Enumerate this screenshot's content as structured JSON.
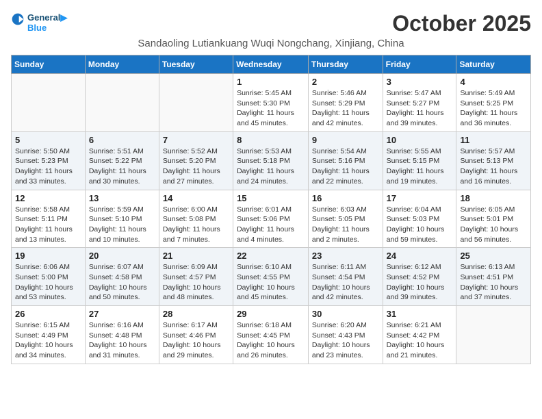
{
  "logo": {
    "line1": "General",
    "line2": "Blue"
  },
  "title": "October 2025",
  "subtitle": "Sandaoling Lutiankuang Wuqi Nongchang, Xinjiang, China",
  "headers": [
    "Sunday",
    "Monday",
    "Tuesday",
    "Wednesday",
    "Thursday",
    "Friday",
    "Saturday"
  ],
  "weeks": [
    [
      {
        "day": "",
        "info": ""
      },
      {
        "day": "",
        "info": ""
      },
      {
        "day": "",
        "info": ""
      },
      {
        "day": "1",
        "info": "Sunrise: 5:45 AM\nSunset: 5:30 PM\nDaylight: 11 hours\nand 45 minutes."
      },
      {
        "day": "2",
        "info": "Sunrise: 5:46 AM\nSunset: 5:29 PM\nDaylight: 11 hours\nand 42 minutes."
      },
      {
        "day": "3",
        "info": "Sunrise: 5:47 AM\nSunset: 5:27 PM\nDaylight: 11 hours\nand 39 minutes."
      },
      {
        "day": "4",
        "info": "Sunrise: 5:49 AM\nSunset: 5:25 PM\nDaylight: 11 hours\nand 36 minutes."
      }
    ],
    [
      {
        "day": "5",
        "info": "Sunrise: 5:50 AM\nSunset: 5:23 PM\nDaylight: 11 hours\nand 33 minutes."
      },
      {
        "day": "6",
        "info": "Sunrise: 5:51 AM\nSunset: 5:22 PM\nDaylight: 11 hours\nand 30 minutes."
      },
      {
        "day": "7",
        "info": "Sunrise: 5:52 AM\nSunset: 5:20 PM\nDaylight: 11 hours\nand 27 minutes."
      },
      {
        "day": "8",
        "info": "Sunrise: 5:53 AM\nSunset: 5:18 PM\nDaylight: 11 hours\nand 24 minutes."
      },
      {
        "day": "9",
        "info": "Sunrise: 5:54 AM\nSunset: 5:16 PM\nDaylight: 11 hours\nand 22 minutes."
      },
      {
        "day": "10",
        "info": "Sunrise: 5:55 AM\nSunset: 5:15 PM\nDaylight: 11 hours\nand 19 minutes."
      },
      {
        "day": "11",
        "info": "Sunrise: 5:57 AM\nSunset: 5:13 PM\nDaylight: 11 hours\nand 16 minutes."
      }
    ],
    [
      {
        "day": "12",
        "info": "Sunrise: 5:58 AM\nSunset: 5:11 PM\nDaylight: 11 hours\nand 13 minutes."
      },
      {
        "day": "13",
        "info": "Sunrise: 5:59 AM\nSunset: 5:10 PM\nDaylight: 11 hours\nand 10 minutes."
      },
      {
        "day": "14",
        "info": "Sunrise: 6:00 AM\nSunset: 5:08 PM\nDaylight: 11 hours\nand 7 minutes."
      },
      {
        "day": "15",
        "info": "Sunrise: 6:01 AM\nSunset: 5:06 PM\nDaylight: 11 hours\nand 4 minutes."
      },
      {
        "day": "16",
        "info": "Sunrise: 6:03 AM\nSunset: 5:05 PM\nDaylight: 11 hours\nand 2 minutes."
      },
      {
        "day": "17",
        "info": "Sunrise: 6:04 AM\nSunset: 5:03 PM\nDaylight: 10 hours\nand 59 minutes."
      },
      {
        "day": "18",
        "info": "Sunrise: 6:05 AM\nSunset: 5:01 PM\nDaylight: 10 hours\nand 56 minutes."
      }
    ],
    [
      {
        "day": "19",
        "info": "Sunrise: 6:06 AM\nSunset: 5:00 PM\nDaylight: 10 hours\nand 53 minutes."
      },
      {
        "day": "20",
        "info": "Sunrise: 6:07 AM\nSunset: 4:58 PM\nDaylight: 10 hours\nand 50 minutes."
      },
      {
        "day": "21",
        "info": "Sunrise: 6:09 AM\nSunset: 4:57 PM\nDaylight: 10 hours\nand 48 minutes."
      },
      {
        "day": "22",
        "info": "Sunrise: 6:10 AM\nSunset: 4:55 PM\nDaylight: 10 hours\nand 45 minutes."
      },
      {
        "day": "23",
        "info": "Sunrise: 6:11 AM\nSunset: 4:54 PM\nDaylight: 10 hours\nand 42 minutes."
      },
      {
        "day": "24",
        "info": "Sunrise: 6:12 AM\nSunset: 4:52 PM\nDaylight: 10 hours\nand 39 minutes."
      },
      {
        "day": "25",
        "info": "Sunrise: 6:13 AM\nSunset: 4:51 PM\nDaylight: 10 hours\nand 37 minutes."
      }
    ],
    [
      {
        "day": "26",
        "info": "Sunrise: 6:15 AM\nSunset: 4:49 PM\nDaylight: 10 hours\nand 34 minutes."
      },
      {
        "day": "27",
        "info": "Sunrise: 6:16 AM\nSunset: 4:48 PM\nDaylight: 10 hours\nand 31 minutes."
      },
      {
        "day": "28",
        "info": "Sunrise: 6:17 AM\nSunset: 4:46 PM\nDaylight: 10 hours\nand 29 minutes."
      },
      {
        "day": "29",
        "info": "Sunrise: 6:18 AM\nSunset: 4:45 PM\nDaylight: 10 hours\nand 26 minutes."
      },
      {
        "day": "30",
        "info": "Sunrise: 6:20 AM\nSunset: 4:43 PM\nDaylight: 10 hours\nand 23 minutes."
      },
      {
        "day": "31",
        "info": "Sunrise: 6:21 AM\nSunset: 4:42 PM\nDaylight: 10 hours\nand 21 minutes."
      },
      {
        "day": "",
        "info": ""
      }
    ]
  ]
}
